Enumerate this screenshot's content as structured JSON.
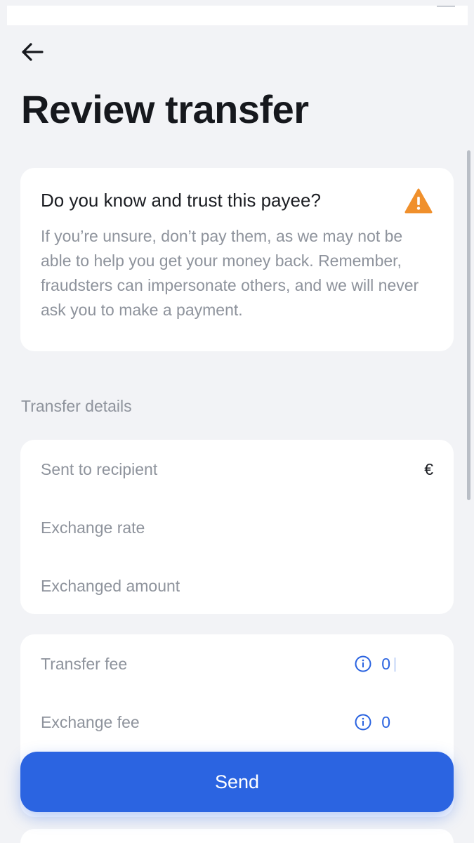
{
  "header": {
    "back_icon": "arrow-left-icon",
    "title": "Review transfer"
  },
  "warning": {
    "title": "Do you know and trust this payee?",
    "icon": "warning-triangle-icon",
    "icon_color": "#f0902c",
    "body": "If you’re unsure, don’t pay them, as we may not be able to help you get your money back. Remember, fraudsters can impersonate others, and we will never ask you to make a payment."
  },
  "details": {
    "section_label": "Transfer details",
    "rows": [
      {
        "label": "Sent to recipient",
        "value": "€"
      },
      {
        "label": "Exchange rate",
        "value": ""
      },
      {
        "label": "Exchanged amount",
        "value": ""
      }
    ]
  },
  "fees": {
    "rows": [
      {
        "label": "Transfer fee",
        "value": "0",
        "icon": "info-icon"
      },
      {
        "label": "Exchange fee",
        "value": "0",
        "icon": "info-icon"
      }
    ]
  },
  "actions": {
    "send_label": "Send",
    "accent_color": "#2b64e1"
  }
}
